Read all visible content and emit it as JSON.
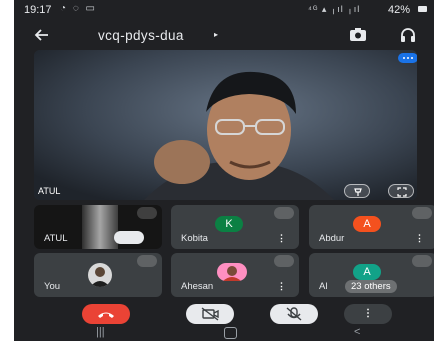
{
  "status_bar": {
    "time": "19:17",
    "left_icons": "◔ ◌ ▭",
    "right_icons": "⁴ᴳ ▴ ╷ıl ╷ıl",
    "battery": "42%"
  },
  "meeting": {
    "code": "vcq-pdys-dua",
    "code_caret": "▸"
  },
  "main_video": {
    "name": "ATUL"
  },
  "tiles": [
    {
      "id": "atul",
      "label": "ATUL"
    },
    {
      "id": "kobita",
      "label": "Kobita",
      "initial": "K",
      "color": "#0b8043"
    },
    {
      "id": "abdur",
      "label": "Abdur",
      "initial": "A",
      "color": "#f4511e"
    },
    {
      "id": "you",
      "label": "You"
    },
    {
      "id": "ahesan",
      "label": "Ahesan"
    },
    {
      "id": "others",
      "label": "Al",
      "initial": "A",
      "color": "#12a288",
      "others_count": "23 others"
    }
  ],
  "menu_glyph": "⋮",
  "controls": {
    "end_glyph": "☎",
    "cam_glyph": "⌧",
    "mic_glyph": "✕",
    "more_glyph": "⋮"
  },
  "navbar": {
    "recents": "|||",
    "back": "<"
  },
  "colors": {
    "end_call": "#ea4335",
    "accent": "#1a73e8",
    "tile_bg": "#3c4043",
    "app_bg": "#202124"
  }
}
